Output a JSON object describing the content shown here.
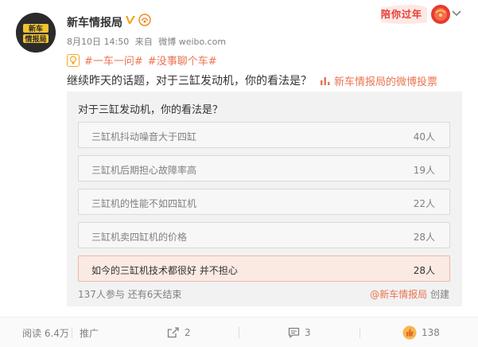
{
  "post": {
    "author_name": "新车情报局",
    "verified_icon": "verified-v-icon",
    "fan_badge_icon": "fan-badge-icon",
    "date": "8月10日 14:50",
    "source_prefix": "来自",
    "source": "微博 weibo.com",
    "festive_banner": "陪你过年",
    "topics": [
      "#一车一问#",
      "#没事聊个车#"
    ],
    "text": "继续昨天的话题，对于三缸发动机，你的看法是？",
    "vote_link": "新车情报局的微博投票"
  },
  "poll": {
    "question": "对于三缸发动机，你的看法是？",
    "options": [
      {
        "label": "三缸机抖动噪音大于四缸",
        "count": "40人",
        "selected": false
      },
      {
        "label": "三缸机后期担心故障率高",
        "count": "19人",
        "selected": false
      },
      {
        "label": "三缸机的性能不如四缸机",
        "count": "22人",
        "selected": false
      },
      {
        "label": "三缸机卖四缸机的价格",
        "count": "28人",
        "selected": false
      },
      {
        "label": "如今的三缸机技术都很好 并不担心",
        "count": "28人",
        "selected": true
      }
    ],
    "summary": "137人参与 还有6天结束",
    "creator": "@新车情报局",
    "creator_suffix": "创建"
  },
  "actions": {
    "reads": "阅读 6.4万",
    "promote": "推广",
    "repost": "2",
    "comment": "3",
    "like": "138"
  },
  "colors": {
    "link": "#eb7350",
    "poll_bg": "#f2f2f2",
    "selected_option_bg": "#fbeae4"
  }
}
